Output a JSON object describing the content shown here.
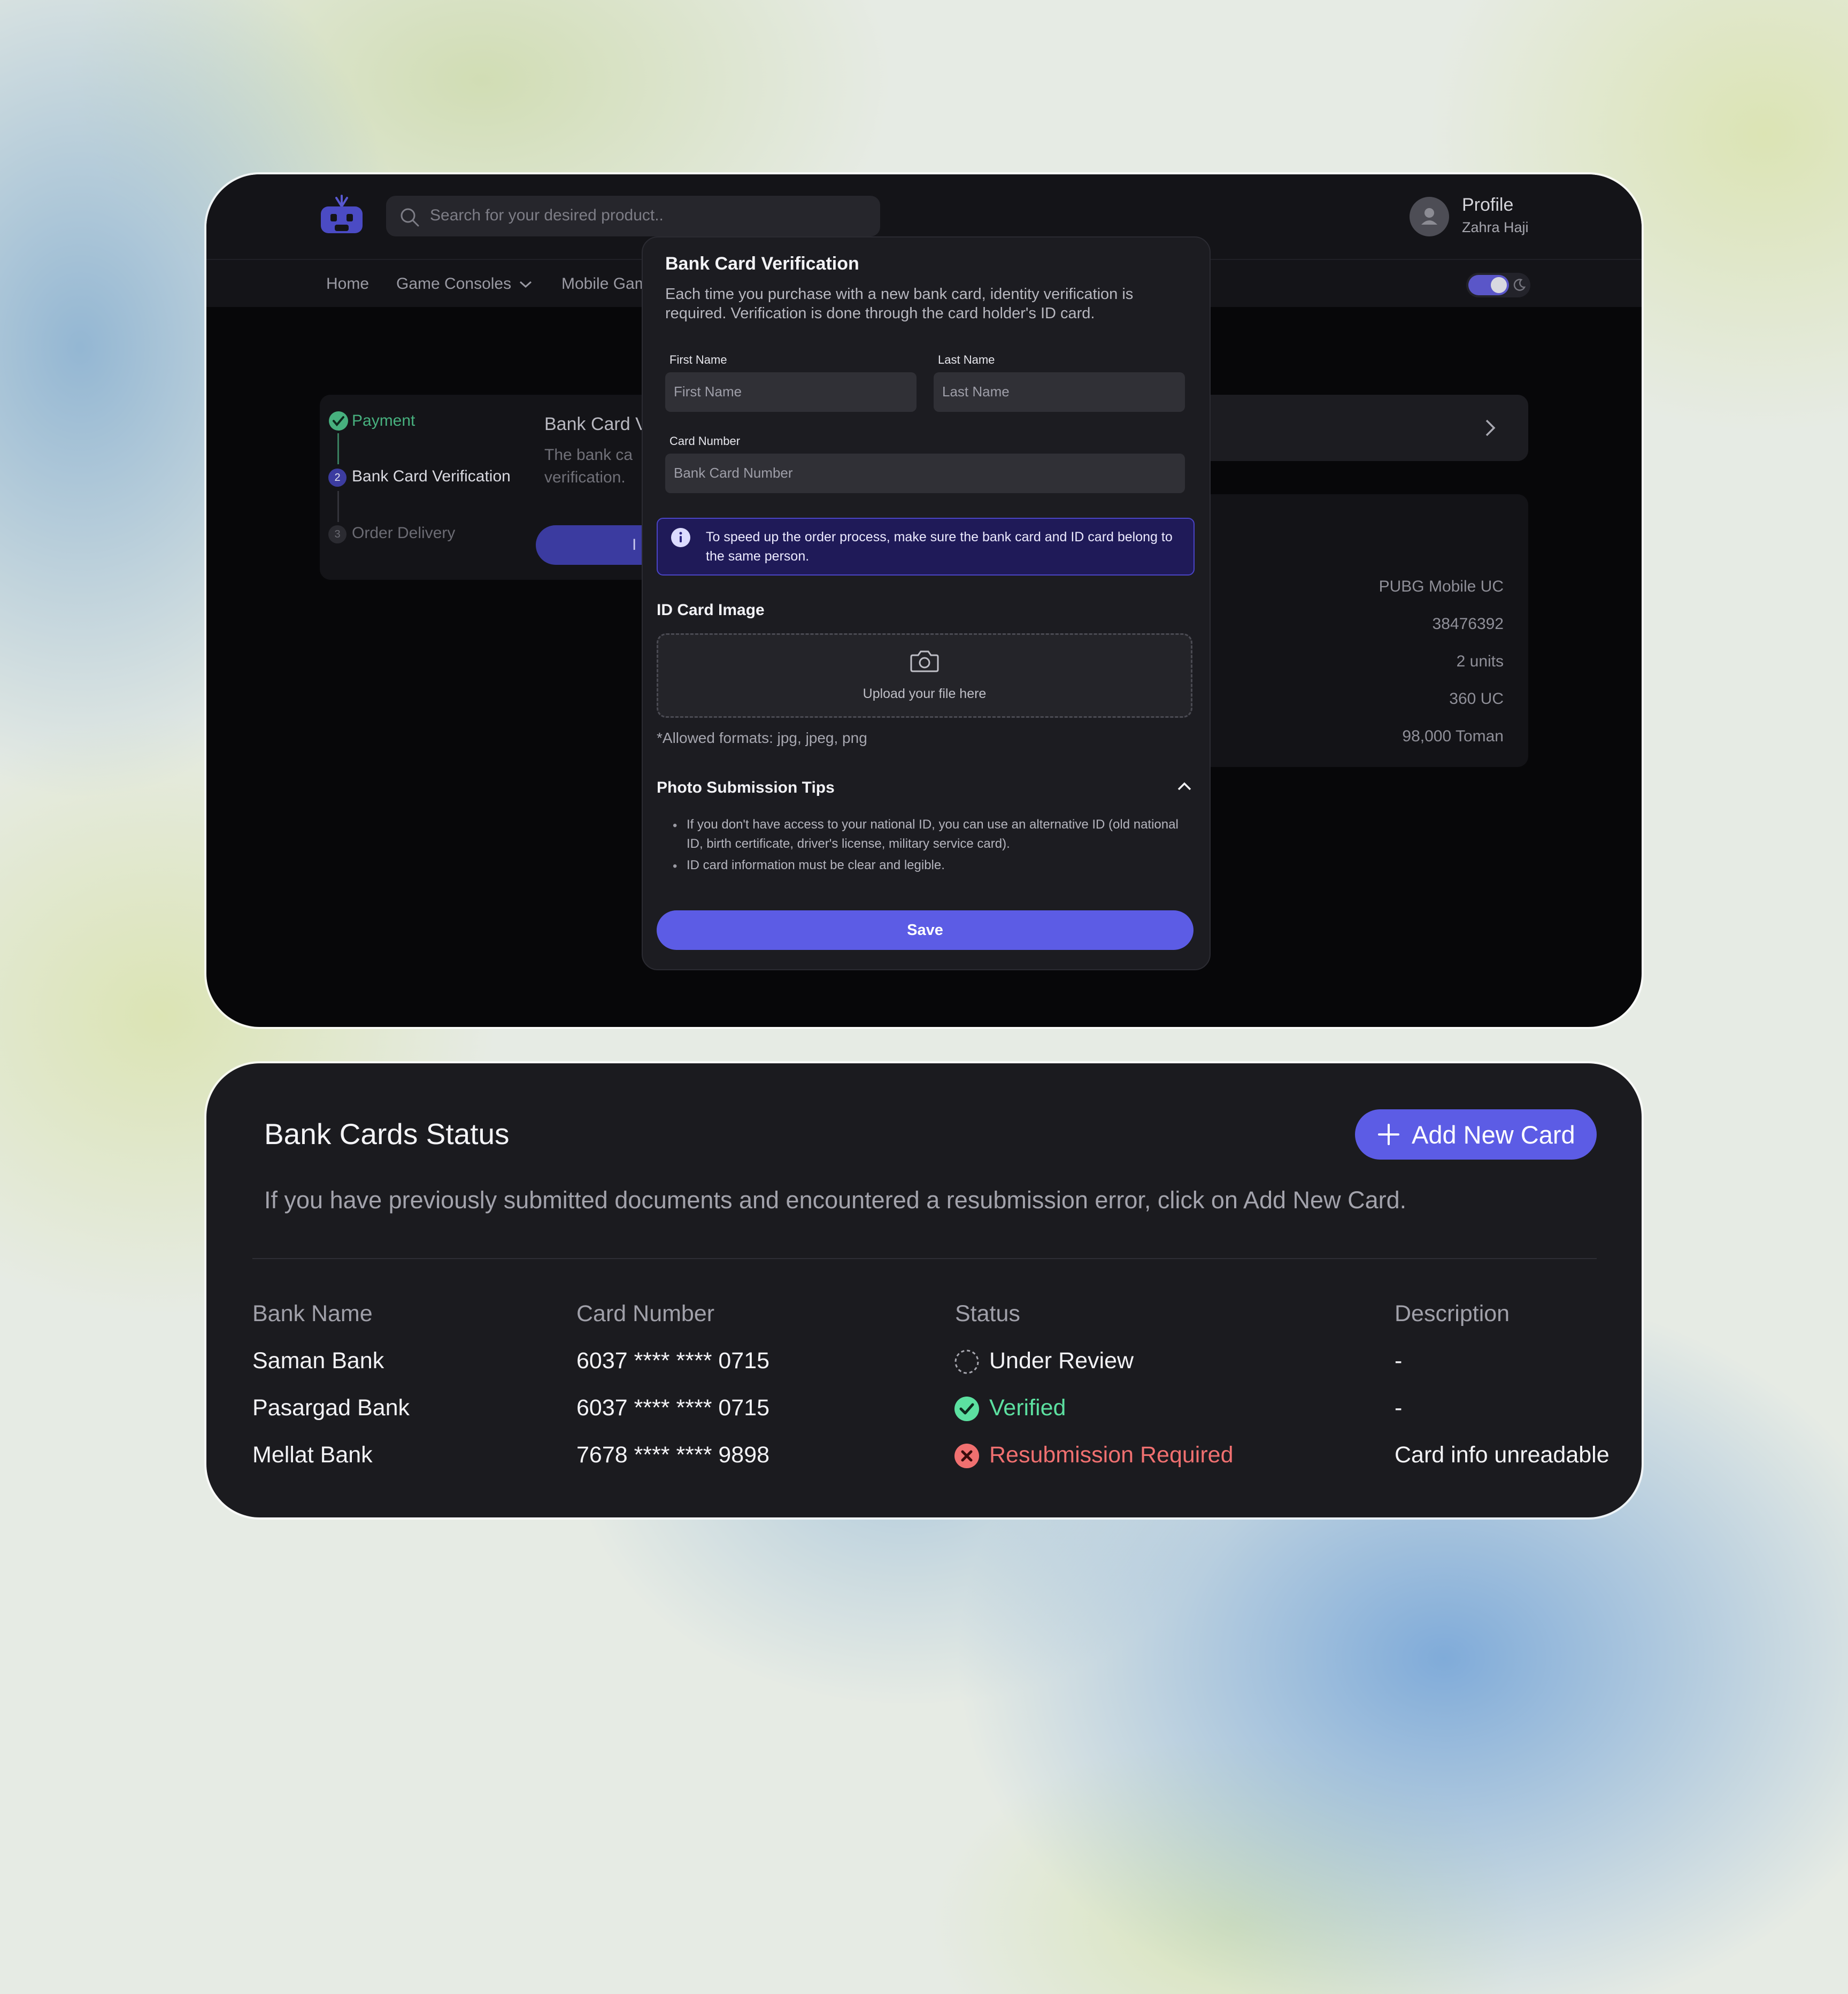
{
  "header": {
    "search_placeholder": "Search for your desired product..",
    "profile_title": "Profile",
    "profile_name": "Zahra Haji",
    "nav": [
      "Home",
      "Game Consoles",
      "Mobile Gam"
    ]
  },
  "checkout": {
    "steps": [
      {
        "number": "1",
        "label": "Payment",
        "status": "done"
      },
      {
        "number": "2",
        "label": "Bank Card Verification",
        "status": "current"
      },
      {
        "number": "3",
        "label": "Order Delivery",
        "status": "pending"
      }
    ],
    "panel_title": "Bank Card V",
    "panel_desc_line1": "The bank ca",
    "panel_desc_line2": "verification.",
    "button_peek": "I",
    "order_details": [
      "PUBG Mobile UC",
      "38476392",
      "2 units",
      "360 UC",
      "98,000 Toman"
    ]
  },
  "modal": {
    "title": "Bank Card Verification",
    "description": "Each time you purchase with a new bank card, identity verification is required. Verification is done through the card holder's ID card.",
    "first_name_label": "First Name",
    "first_name_placeholder": "First Name",
    "last_name_label": "Last Name",
    "last_name_placeholder": "Last Name",
    "card_number_label": "Card Number",
    "card_number_placeholder": "Bank Card Number",
    "info_text": "To speed up the order process, make sure the bank card and ID card belong to the same person.",
    "id_card_title": "ID Card Image",
    "upload_text": "Upload your file here",
    "allowed_formats": "*Allowed formats: jpg, jpeg, png",
    "tips_title": "Photo Submission Tips",
    "tips": [
      "If you don't have access to your national ID, you can use an alternative ID (old national ID, birth certificate, driver's license, military service card).",
      "ID card information must be clear and legible."
    ],
    "save_label": "Save"
  },
  "status_card": {
    "title": "Bank Cards Status",
    "add_button": "Add New Card",
    "description": "If you have previously submitted documents and encountered a resubmission error, click on Add New Card.",
    "columns": [
      "Bank Name",
      "Card Number",
      "Status",
      "Description"
    ],
    "rows": [
      {
        "bank": "Saman Bank",
        "card": "6037 **** **** 0715",
        "status": "Under Review",
        "status_type": "pending",
        "description": "-"
      },
      {
        "bank": "Pasargad Bank",
        "card": "6037 **** **** 0715",
        "status": "Verified",
        "status_type": "verified",
        "description": "-"
      },
      {
        "bank": "Mellat Bank",
        "card": "7678 **** **** 9898",
        "status": "Resubmission Required",
        "status_type": "rejected",
        "description": "Card info unreadable"
      }
    ]
  },
  "colors": {
    "accent": "#5c5ce5",
    "verified": "#5ce0a0",
    "rejected": "#f07070",
    "payment_done": "#47b07e"
  }
}
